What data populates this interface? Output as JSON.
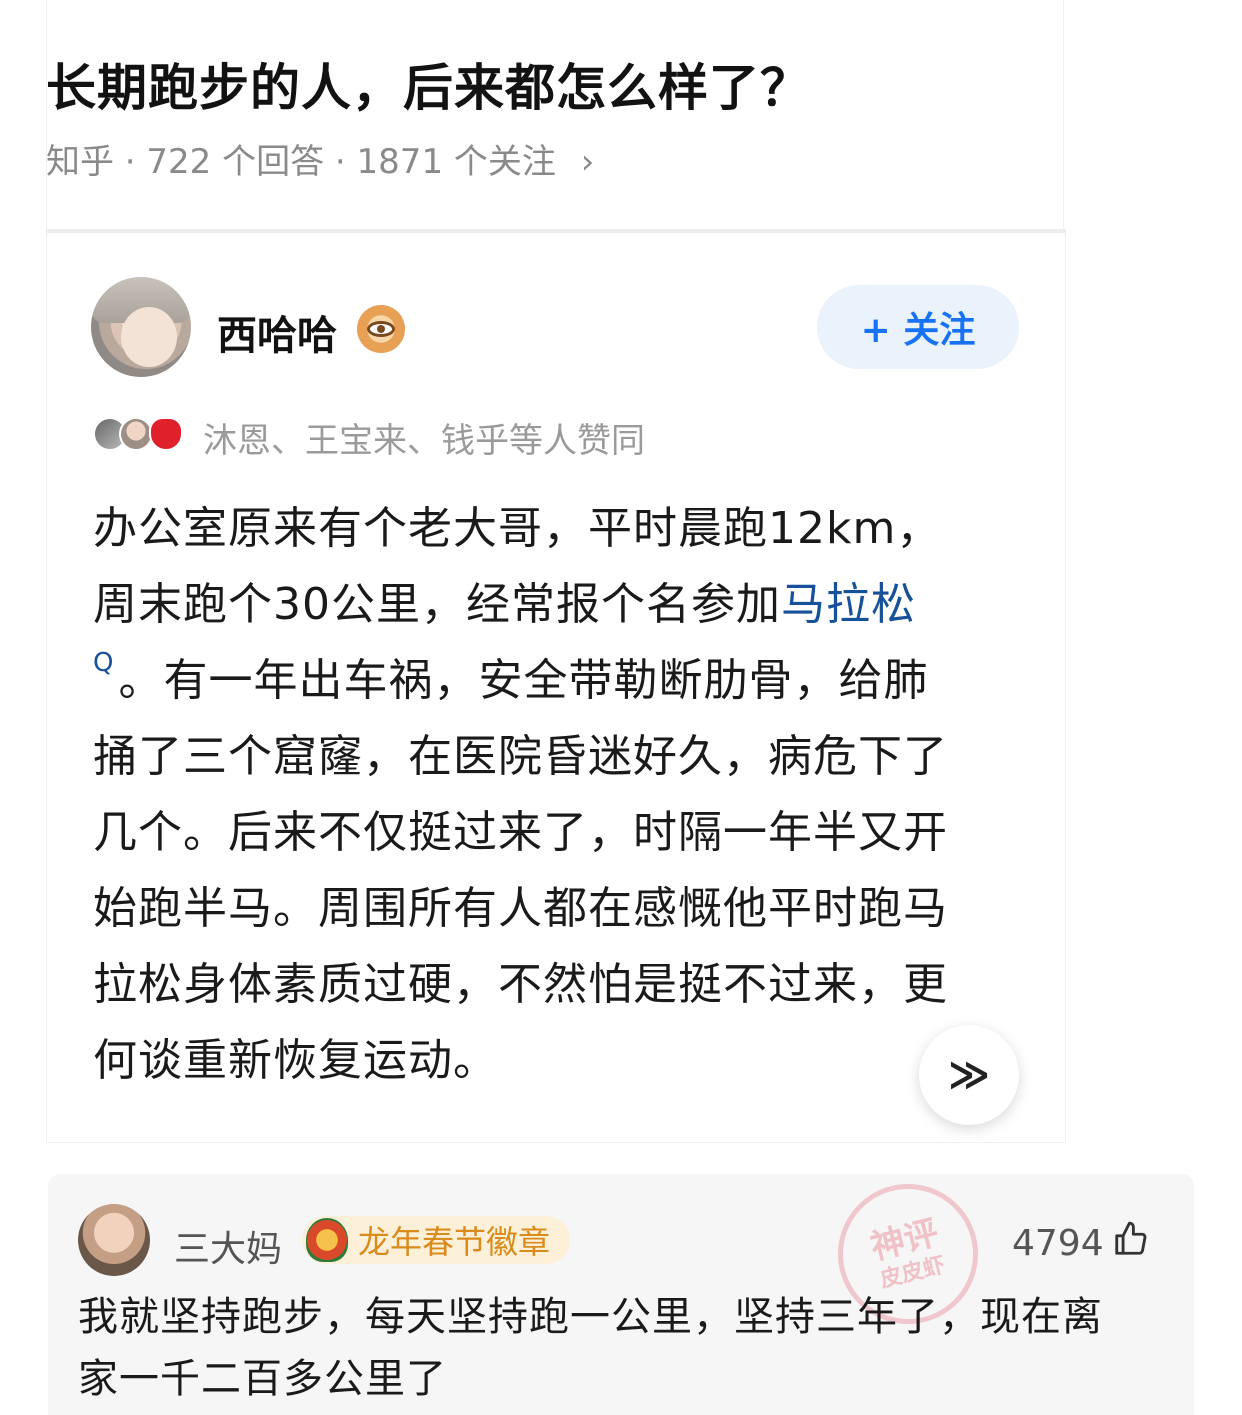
{
  "question": {
    "title": "长期跑步的人，后来都怎么样了？",
    "meta": "知乎 · 722 个回答 · 1871 个关注",
    "chevron": "›"
  },
  "answer": {
    "author": "西哈哈",
    "author_badge_icon": "eye-badge-icon",
    "follow_label": "+ 关注",
    "voters_text": "沐恩、王宝来、钱乎等人赞同",
    "lines": [
      "办公室原来有个老大哥，平时晨跑12km，",
      "周末跑个30公里，经常报个名参加",
      "。有一年出车祸，安全带勒断肋骨，给肺",
      "捅了三个窟窿，在医院昏迷好久，病危下了",
      "几个。后来不仅挺过来了，时隔一年半又开",
      "始跑半马。周围所有人都在感慨他平时跑马",
      "拉松身体素质过硬，不然怕是挺不过来，更",
      "何谈重新恢复运动。"
    ],
    "link_text": "马拉松",
    "search_mark": "Q",
    "expand_glyph": "≫",
    "link_color": "#175199"
  },
  "comment": {
    "name": "三大妈",
    "badge": "龙年春节徽章",
    "stamp_top": "神评",
    "stamp_bottom": "皮皮虾",
    "likes": "4794",
    "thumb_glyph": "👍",
    "lines": [
      "我就坚持跑步，每天坚持跑一公里，坚持三年了，现在离",
      "家一千二百多公里了"
    ]
  }
}
